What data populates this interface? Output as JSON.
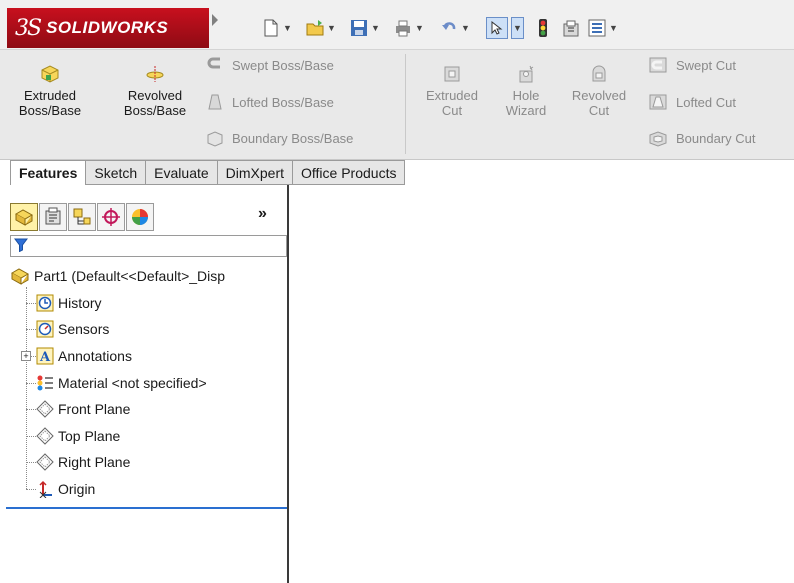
{
  "app": {
    "brand_mark": "3S",
    "brand_name": "SOLIDWORKS"
  },
  "ribbon": {
    "extruded_boss": "Extruded\nBoss/Base",
    "revolved_boss": "Revolved\nBoss/Base",
    "swept_boss": "Swept Boss/Base",
    "lofted_boss": "Lofted Boss/Base",
    "boundary_boss": "Boundary Boss/Base",
    "extruded_cut": "Extruded\nCut",
    "hole_wizard": "Hole\nWizard",
    "revolved_cut": "Revolved\nCut",
    "swept_cut": "Swept Cut",
    "lofted_cut": "Lofted Cut",
    "boundary_cut": "Boundary Cut"
  },
  "tabs": [
    "Features",
    "Sketch",
    "Evaluate",
    "DimXpert",
    "Office Products"
  ],
  "panel": {
    "more": "»"
  },
  "tree": {
    "root": "Part1  (Default<<Default>_Disp",
    "items": [
      "History",
      "Sensors",
      "Annotations",
      "Material <not specified>",
      "Front Plane",
      "Top Plane",
      "Right Plane",
      "Origin"
    ]
  },
  "colors": {
    "brand": "#c8101e",
    "accent": "#2a6fd0"
  }
}
